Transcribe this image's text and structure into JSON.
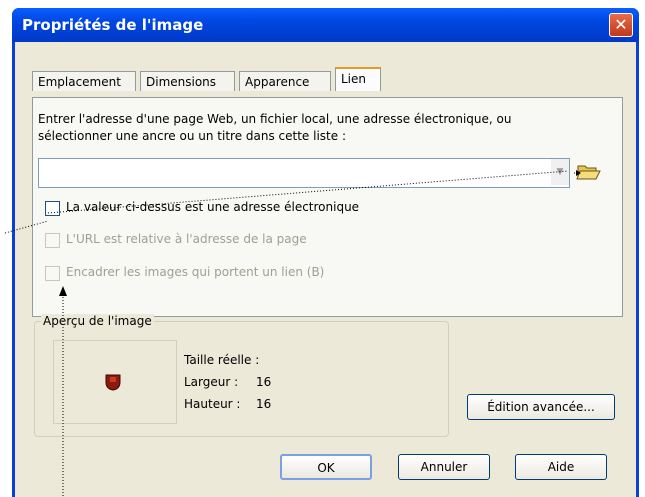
{
  "window": {
    "title": "Propriétés de l'image",
    "close_glyph": "✕"
  },
  "tabs": [
    {
      "label": "Emplacement"
    },
    {
      "label": "Dimensions"
    },
    {
      "label": "Apparence"
    },
    {
      "label": "Lien"
    }
  ],
  "link_panel": {
    "instruction_line1": "Entrer l'adresse d'une page Web, un fichier local, une adresse électronique, ou",
    "instruction_line2": "sélectionner une ancre ou un titre dans cette liste :",
    "url_value": "",
    "options": [
      {
        "label": "La valeur ci-dessus est une adresse électronique",
        "enabled": true,
        "checked": false
      },
      {
        "label": "L'URL est relative à l'adresse de la page",
        "enabled": false,
        "checked": true
      },
      {
        "label": "Encadrer les images qui portent un lien (B)",
        "enabled": false,
        "checked": false
      }
    ]
  },
  "preview": {
    "group_title": "Aperçu de l'image",
    "actual_size_label": "Taille réelle :",
    "width_label": "Largeur :",
    "width_value": "16",
    "height_label": "Hauteur :",
    "height_value": "16"
  },
  "buttons": {
    "advanced": "Édition avancée...",
    "ok": "OK",
    "cancel": "Annuler",
    "help": "Aide"
  },
  "colors": {
    "titlebar": "#0046e0",
    "dialog_bg": "#ece9d8",
    "close": "#c2381a"
  }
}
